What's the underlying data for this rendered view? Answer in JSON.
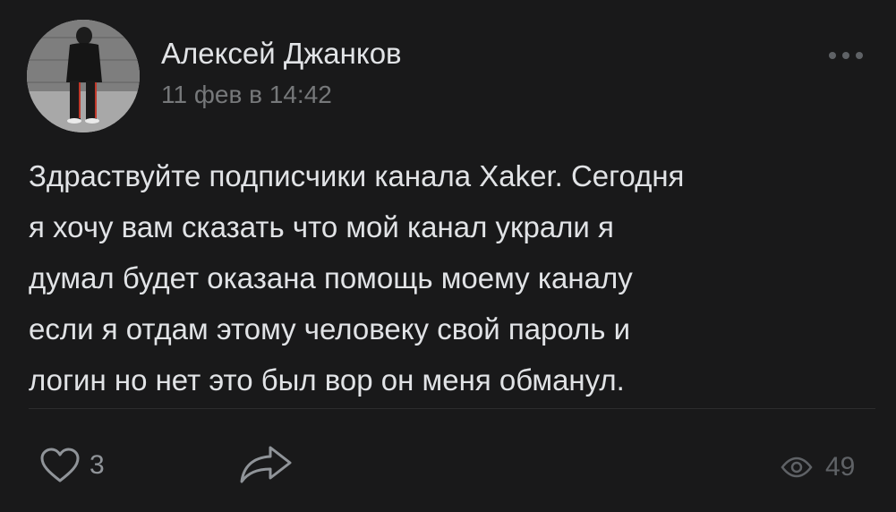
{
  "post": {
    "author": {
      "name": "Алексей Джанков",
      "avatar_icon": "user-photo-avatar"
    },
    "date": "11 фев в 14:42",
    "menu_icon": "more-horizontal-icon",
    "text_lines": [
      "Здраствуйте подписчики канала Xaker. Сегодня",
      "я хочу вам сказать что мой канал украли я",
      "думал будет оказана помощь моему каналу",
      "если я отдам этому человеку свой пароль и",
      "логин но нет это был вор он меня обманул."
    ],
    "actions": {
      "like_icon": "heart-icon",
      "likes": "3",
      "share_icon": "share-arrow-icon",
      "views_icon": "eye-icon",
      "views": "49"
    }
  },
  "colors": {
    "background": "#19191a",
    "text_primary": "#e1e3e6",
    "text_secondary": "#76787a",
    "icon_muted": "#909499",
    "divider": "#2c2d2e"
  }
}
